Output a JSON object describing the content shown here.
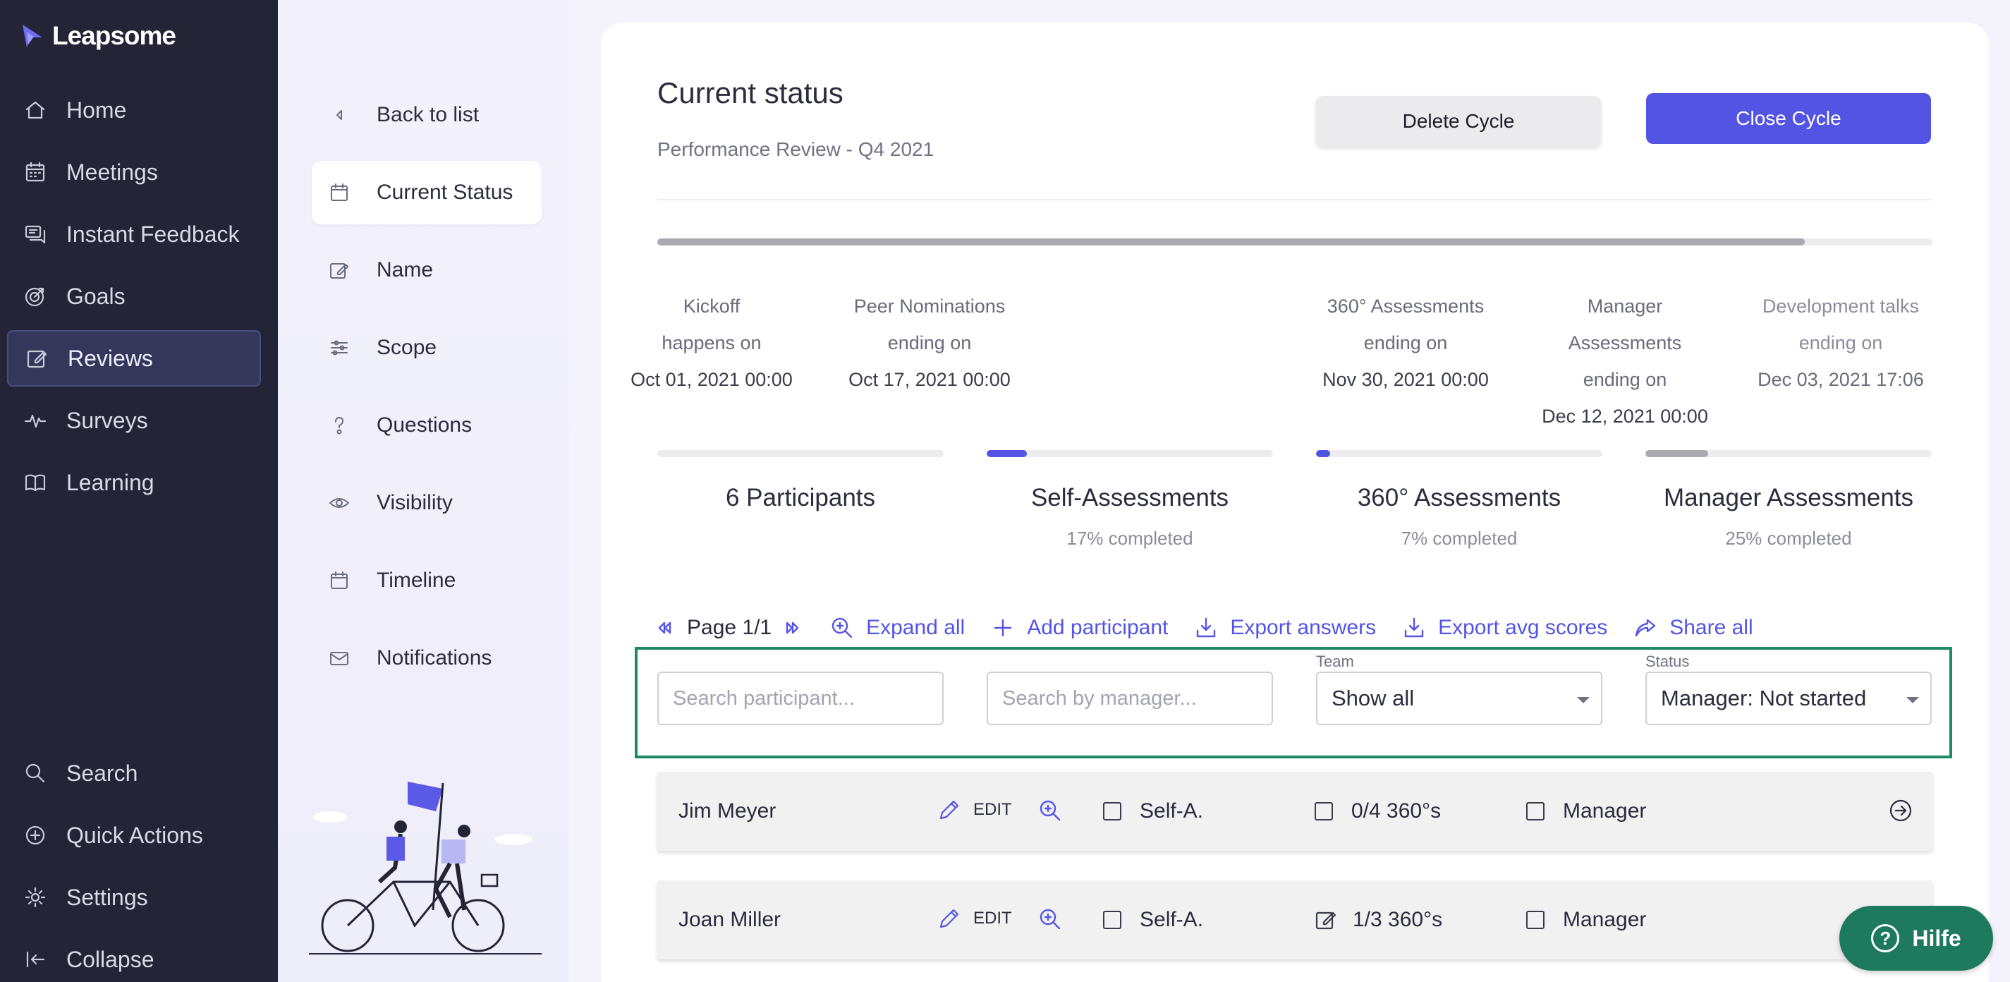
{
  "app": {
    "name": "Leapsome"
  },
  "nav": {
    "items": [
      {
        "label": "Home",
        "icon": "home-icon"
      },
      {
        "label": "Meetings",
        "icon": "calendar-icon"
      },
      {
        "label": "Instant Feedback",
        "icon": "chat-icon"
      },
      {
        "label": "Goals",
        "icon": "target-icon"
      },
      {
        "label": "Reviews",
        "icon": "edit-icon",
        "active": true
      },
      {
        "label": "Surveys",
        "icon": "pulse-icon"
      },
      {
        "label": "Learning",
        "icon": "book-icon"
      }
    ],
    "bottom": [
      {
        "label": "Search",
        "icon": "search-icon"
      },
      {
        "label": "Quick Actions",
        "icon": "plus-circle-icon"
      },
      {
        "label": "Settings",
        "icon": "gear-icon"
      },
      {
        "label": "Collapse",
        "icon": "collapse-icon"
      }
    ]
  },
  "subnav": {
    "items": [
      {
        "label": "Back to list",
        "icon": "chevron-left-icon"
      },
      {
        "label": "Current Status",
        "icon": "calendar-icon",
        "active": true
      },
      {
        "label": "Name",
        "icon": "edit-icon"
      },
      {
        "label": "Scope",
        "icon": "sliders-icon"
      },
      {
        "label": "Questions",
        "icon": "question-icon"
      },
      {
        "label": "Visibility",
        "icon": "eye-icon"
      },
      {
        "label": "Timeline",
        "icon": "calendar-icon"
      },
      {
        "label": "Notifications",
        "icon": "mail-icon"
      }
    ]
  },
  "header": {
    "title": "Current status",
    "subtitle": "Performance Review - Q4 2021",
    "delete_label": "Delete Cycle",
    "close_label": "Close Cycle"
  },
  "timeline": {
    "progress": 0.9,
    "milestones": [
      {
        "line1": "Kickoff",
        "line2": "happens on",
        "date": "Oct 01, 2021 00:00"
      },
      {
        "line1": "Peer Nominations",
        "line2": "ending on",
        "date": "Oct 17, 2021 00:00"
      },
      {
        "line1": "360° Assessments",
        "line2": "ending on",
        "date": "Nov 30, 2021 00:00"
      },
      {
        "line1": "Manager",
        "line2": "Assessments",
        "line3": "ending on",
        "date": "Dec 12, 2021 00:00"
      },
      {
        "line1": "Development talks",
        "line2": "ending on",
        "date": "Dec 03, 2021 17:06"
      }
    ]
  },
  "stats": [
    {
      "label": "6 Participants",
      "sub": "",
      "progress": 0,
      "color": "#ececef"
    },
    {
      "label": "Self-Assessments",
      "sub": "17% completed",
      "progress": 0.14,
      "color": "#5454e4"
    },
    {
      "label": "360° Assessments",
      "sub": "7% completed",
      "progress": 0.05,
      "color": "#5454e4"
    },
    {
      "label": "Manager Assessments",
      "sub": "25% completed",
      "progress": 0.22,
      "color": "#a9a9af"
    }
  ],
  "toolbar": {
    "page": "Page 1/1",
    "expand": "Expand all",
    "add": "Add participant",
    "export_answers": "Export answers",
    "export_avg": "Export avg scores",
    "share": "Share all"
  },
  "filters": {
    "participant_placeholder": "Search participant...",
    "manager_placeholder": "Search by manager...",
    "team_label": "Team",
    "team_value": "Show all",
    "status_label": "Status",
    "status_value": "Manager: Not started"
  },
  "rows": [
    {
      "name": "Jim Meyer",
      "edit": "EDIT",
      "self": "Self-A.",
      "peer": "0/4 360°s",
      "manager": "Manager"
    },
    {
      "name": "Joan Miller",
      "edit": "EDIT",
      "self": "Self-A.",
      "peer": "1/3 360°s",
      "manager": "Manager"
    }
  ],
  "help": {
    "label": "Hilfe"
  }
}
